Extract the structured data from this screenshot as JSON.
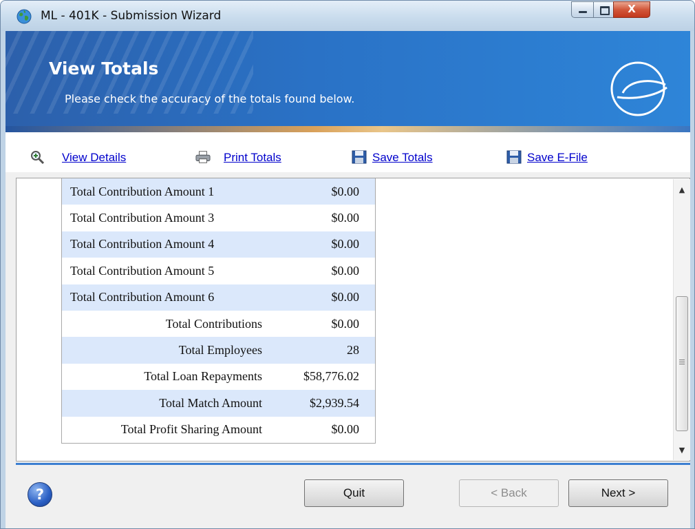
{
  "window": {
    "title": "ML - 401K - Submission Wizard",
    "controls": {
      "minimize": "minimize",
      "maximize": "maximize",
      "close": "X"
    }
  },
  "header": {
    "title": "View Totals",
    "subtitle": "Please check the accuracy of the totals found below."
  },
  "toolbar": {
    "view_details": "View Details",
    "print_totals": "Print Totals",
    "save_totals": "Save Totals",
    "save_efile": "Save E-File"
  },
  "totals": [
    {
      "label": "Total Contribution Amount 1",
      "value": "$0.00",
      "align": "left"
    },
    {
      "label": "Total Contribution Amount 3",
      "value": "$0.00",
      "align": "left"
    },
    {
      "label": "Total Contribution Amount 4",
      "value": "$0.00",
      "align": "left"
    },
    {
      "label": "Total Contribution Amount 5",
      "value": "$0.00",
      "align": "left"
    },
    {
      "label": "Total Contribution Amount 6",
      "value": "$0.00",
      "align": "left"
    },
    {
      "label": "Total Contributions",
      "value": "$0.00",
      "align": "right"
    },
    {
      "label": "Total Employees",
      "value": "28",
      "align": "right"
    },
    {
      "label": "Total Loan Repayments",
      "value": "$58,776.02",
      "align": "right"
    },
    {
      "label": "Total Match Amount",
      "value": "$2,939.54",
      "align": "right"
    },
    {
      "label": "Total Profit Sharing Amount",
      "value": "$0.00",
      "align": "right"
    }
  ],
  "footer": {
    "help": "?",
    "quit": "Quit",
    "back": "< Back",
    "next": "Next >"
  },
  "icons": {
    "app": "globe-icon",
    "view_details": "magnifier-icon",
    "print_totals": "printer-icon",
    "save": "floppy-disk-icon",
    "logo": "e-logo-icon",
    "help": "help-icon"
  },
  "colors": {
    "banner": "#2a72c6",
    "link": "#0000cc",
    "row_alt": "#dbe8fb",
    "accent_line": "#3c7fd1"
  }
}
